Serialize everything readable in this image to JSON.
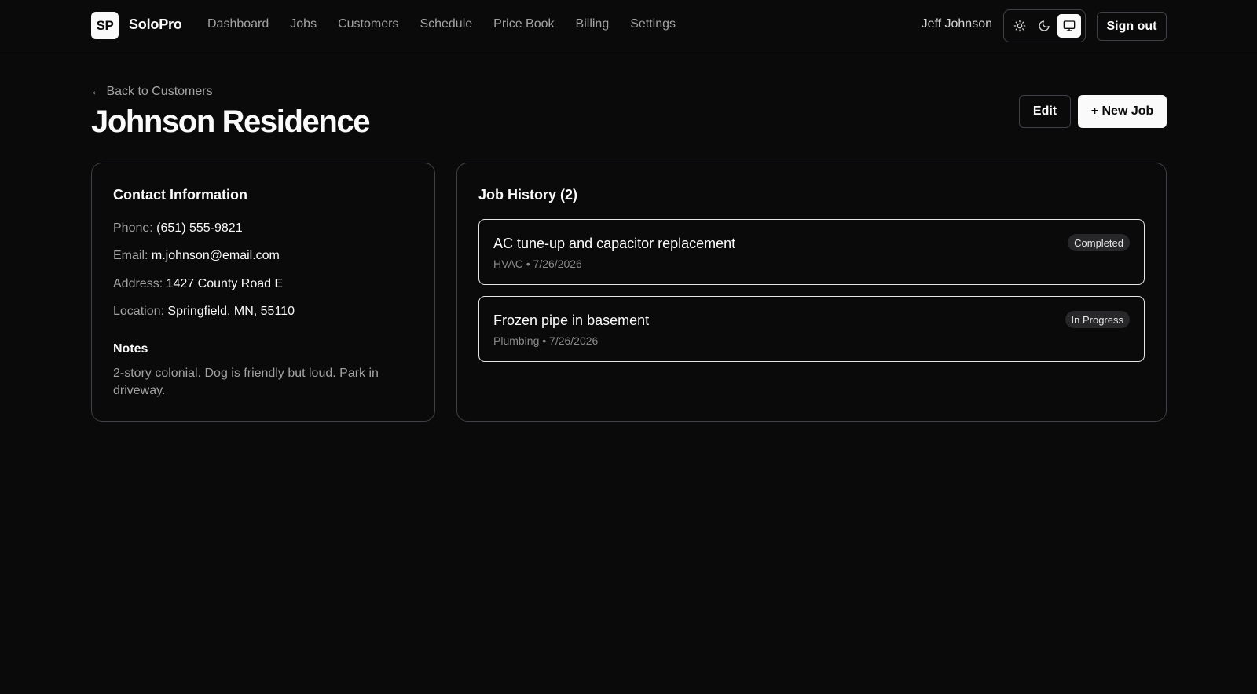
{
  "app": {
    "logo_text": "SP",
    "name": "SoloPro"
  },
  "nav": {
    "items": [
      {
        "label": "Dashboard"
      },
      {
        "label": "Jobs"
      },
      {
        "label": "Customers"
      },
      {
        "label": "Schedule"
      },
      {
        "label": "Price Book"
      },
      {
        "label": "Billing"
      },
      {
        "label": "Settings"
      }
    ]
  },
  "header": {
    "user_name": "Jeff Johnson",
    "theme_options": [
      {
        "icon": "sun-icon",
        "label": "Light"
      },
      {
        "icon": "moon-icon",
        "label": "Dark"
      },
      {
        "icon": "monitor-icon",
        "label": "System",
        "active": true
      }
    ],
    "sign_out_label": "Sign out"
  },
  "page": {
    "back_label": "← Back to Customers",
    "title": "Johnson Residence",
    "edit_label": "Edit",
    "new_job_label": "+ New Job"
  },
  "contact": {
    "title": "Contact Information",
    "phone_label": "Phone:",
    "phone": "(651) 555-9821",
    "email_label": "Email:",
    "email": "m.johnson@email.com",
    "address_label": "Address:",
    "address": "1427 County Road E",
    "location_label": "Location:",
    "location": "Springfield, MN, 55110",
    "notes_title": "Notes",
    "notes": "2-story colonial. Dog is friendly but loud. Park in driveway."
  },
  "history": {
    "title": "Job History (2)",
    "jobs": [
      {
        "title": "AC tune-up and capacitor replacement",
        "meta": "HVAC • 7/26/2026",
        "status": "Completed"
      },
      {
        "title": "Frozen pipe in basement",
        "meta": "Plumbing • 7/26/2026",
        "status": "In Progress"
      }
    ]
  },
  "colors": {
    "background": "#0a0a0b",
    "foreground": "#fafafa",
    "muted": "#a3a3a3",
    "border": "#3f3f46",
    "badge_bg": "#27272a"
  }
}
